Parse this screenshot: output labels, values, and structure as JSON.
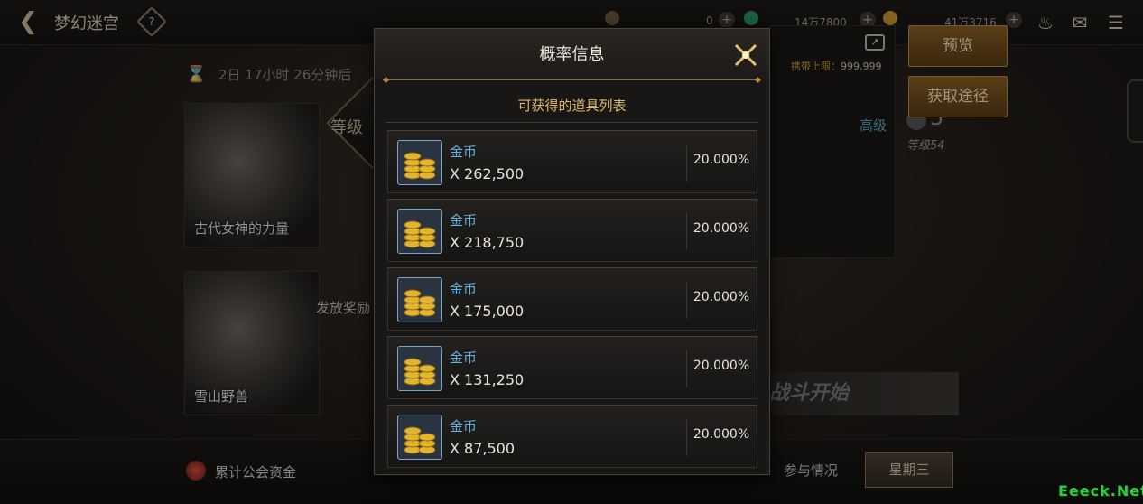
{
  "header": {
    "title": "梦幻迷宫",
    "help_label": "?",
    "currencies": [
      {
        "icon": "gold-coin-icon",
        "value": "0"
      },
      {
        "icon": "emerald-icon",
        "value": "14万7800"
      },
      {
        "icon": "coin-icon",
        "value": "41万3716"
      }
    ]
  },
  "main": {
    "timer_text": "2日 17小时 26分钟后",
    "cards": [
      {
        "label": "古代女神的力量"
      },
      {
        "label": "雪山野兽"
      }
    ],
    "level_text": "等级",
    "reward_text": "发放奖励",
    "carry_limit_label": "携带上限：",
    "carry_limit_value": "999,999",
    "advanced_label": "高级",
    "level_req": "等级54",
    "big_number": "5",
    "battle_start": "战斗开始"
  },
  "side_buttons": {
    "preview": "预览",
    "obtain": "获取途径"
  },
  "bottom": {
    "guild_funds": "累计公会资金",
    "participation": "参与情况",
    "weekday": "星期三"
  },
  "watermark": "Eeeck.Net",
  "modal": {
    "title": "概率信息",
    "subtitle": "可获得的道具列表",
    "items": [
      {
        "name": "金币",
        "qty": "X 262,500",
        "prob": "20.000%"
      },
      {
        "name": "金币",
        "qty": "X 218,750",
        "prob": "20.000%"
      },
      {
        "name": "金币",
        "qty": "X 175,000",
        "prob": "20.000%"
      },
      {
        "name": "金币",
        "qty": "X 131,250",
        "prob": "20.000%"
      },
      {
        "name": "金币",
        "qty": "X 87,500",
        "prob": "20.000%"
      }
    ]
  },
  "colors": {
    "accent_gold": "#e0b86a",
    "item_name_blue": "#63b0dc",
    "button_bronze": "#8a5f25"
  }
}
